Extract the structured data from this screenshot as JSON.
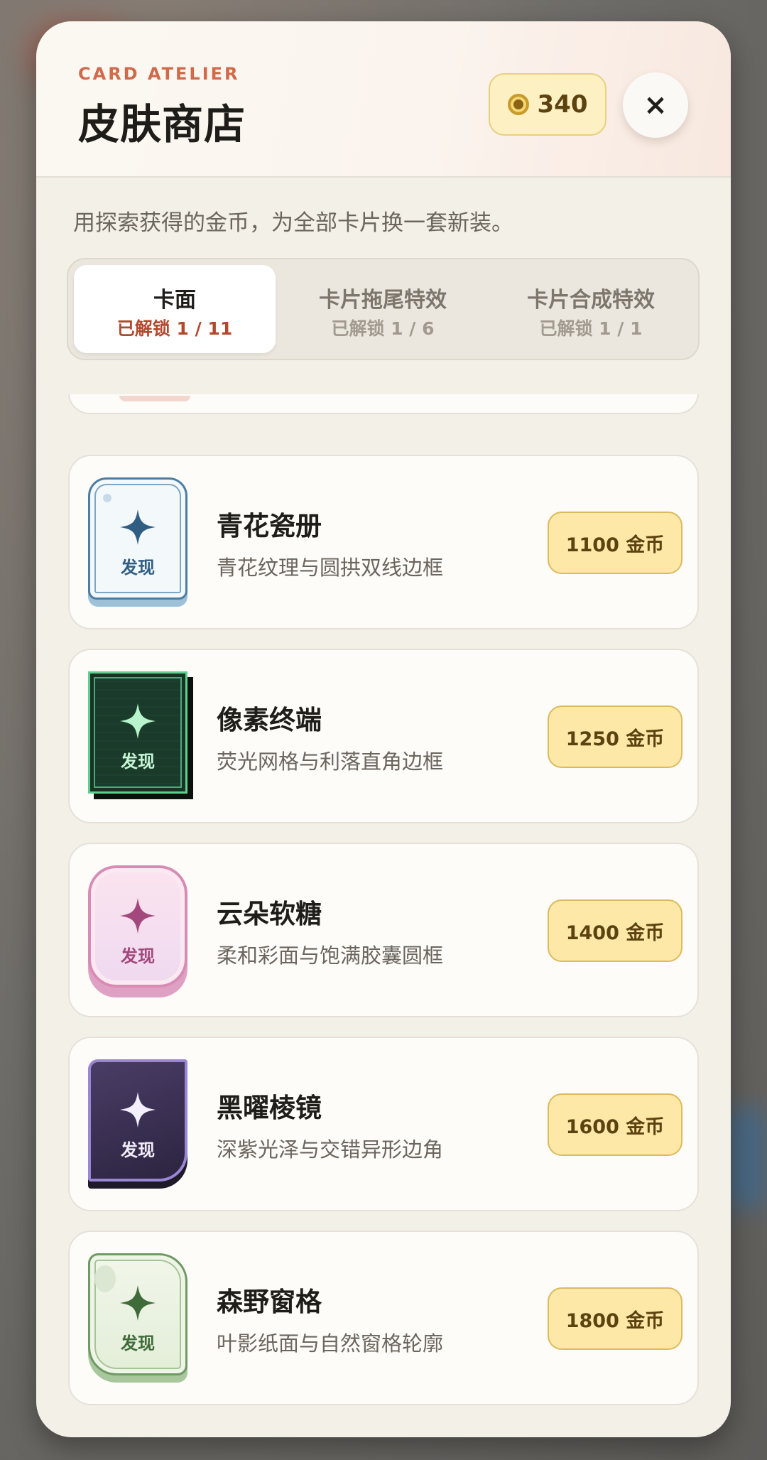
{
  "shop": {
    "eyebrow": "CARD ATELIER",
    "title": "皮肤商店",
    "coins": "340",
    "close_symbol": "×",
    "intro": "用探索获得的金币，为全部卡片换一套新装。"
  },
  "tabs": [
    {
      "label": "卡面",
      "unlocked": "已解锁 1 / 11",
      "active": true
    },
    {
      "label": "卡片拖尾特效",
      "unlocked": "已解锁 1 / 6",
      "active": false
    },
    {
      "label": "卡片合成特效",
      "unlocked": "已解锁 1 / 1",
      "active": false
    }
  ],
  "thumb_label": "发现",
  "items": [
    {
      "name": "青花瓷册",
      "desc": "青花纹理与圆拱双线边框",
      "price": "1100 金币",
      "star_color": "#2f5e82"
    },
    {
      "name": "像素终端",
      "desc": "荧光网格与利落直角边框",
      "price": "1250 金币",
      "star_color": "#b8f5cc"
    },
    {
      "name": "云朵软糖",
      "desc": "柔和彩面与饱满胶囊圆框",
      "price": "1400 金币",
      "star_color": "#a2487c"
    },
    {
      "name": "黑曜棱镜",
      "desc": "深紫光泽与交错异形边角",
      "price": "1600 金币",
      "star_color": "#f3efff"
    },
    {
      "name": "森野窗格",
      "desc": "叶影纸面与自然窗格轮廓",
      "price": "1800 金币",
      "star_color": "#3e6b39"
    }
  ],
  "colors": {
    "accent": "#d06a4a",
    "coin_badge": "#fdf0c2",
    "price_button": "#fde8a7",
    "panel": "#f3f0e8"
  }
}
